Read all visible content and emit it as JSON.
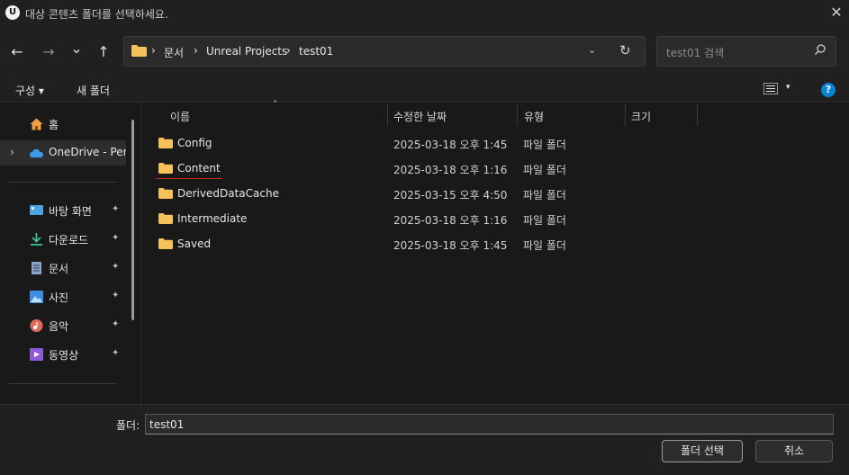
{
  "window": {
    "title": "대상 콘텐츠 폴더를 선택하세요.",
    "logo_text": "U",
    "close_symbol": "✕"
  },
  "nav": {
    "back": "←",
    "forward": "→",
    "recent": "⌄",
    "up": "↑",
    "breadcrumbs": [
      "문서",
      "Unreal Projects",
      "test01"
    ],
    "separator": "›",
    "dropdown_symbol": "⌄",
    "refresh_symbol": "↻",
    "search_placeholder": "test01 검색",
    "search_symbol": "⚲"
  },
  "commandbar": {
    "organize": "구성 ▾",
    "new_folder": "새 폴더",
    "view_dropdown": "▾",
    "help": "?"
  },
  "sidebar": {
    "home": "홈",
    "onedrive": "OneDrive - Pers",
    "chevron": "›",
    "pin": "📌",
    "quick": [
      {
        "label": "바탕 화면",
        "icon": "desktop-icon",
        "color": "#4fa3e0"
      },
      {
        "label": "다운로드",
        "icon": "download-icon",
        "color": "#3ec48a"
      },
      {
        "label": "문서",
        "icon": "documents-icon",
        "color": "#8da4c8"
      },
      {
        "label": "사진",
        "icon": "pictures-icon",
        "color": "#3b8ee0"
      },
      {
        "label": "음악",
        "icon": "music-icon",
        "color": "#e06a5a"
      },
      {
        "label": "동영상",
        "icon": "videos-icon",
        "color": "#8e5ad8"
      }
    ]
  },
  "columns": {
    "name": "이름",
    "date": "수정한 날짜",
    "type": "유형",
    "size": "크기",
    "sort_symbol": "⌃"
  },
  "files": [
    {
      "name": "Config",
      "date": "2025-03-18 오후 1:45",
      "type": "파일 폴더"
    },
    {
      "name": "Content",
      "date": "2025-03-18 오후 1:16",
      "type": "파일 폴더"
    },
    {
      "name": "DerivedDataCache",
      "date": "2025-03-15 오후 4:50",
      "type": "파일 폴더"
    },
    {
      "name": "Intermediate",
      "date": "2025-03-18 오후 1:16",
      "type": "파일 폴더"
    },
    {
      "name": "Saved",
      "date": "2025-03-18 오후 1:45",
      "type": "파일 폴더"
    }
  ],
  "footer": {
    "folder_label": "폴더:",
    "folder_value": "test01",
    "select_button": "폴더 선택",
    "cancel_button": "취소"
  },
  "colors": {
    "folder": "#f4c15a",
    "accent": "#0a84d8",
    "underline": "#c42b1c"
  }
}
